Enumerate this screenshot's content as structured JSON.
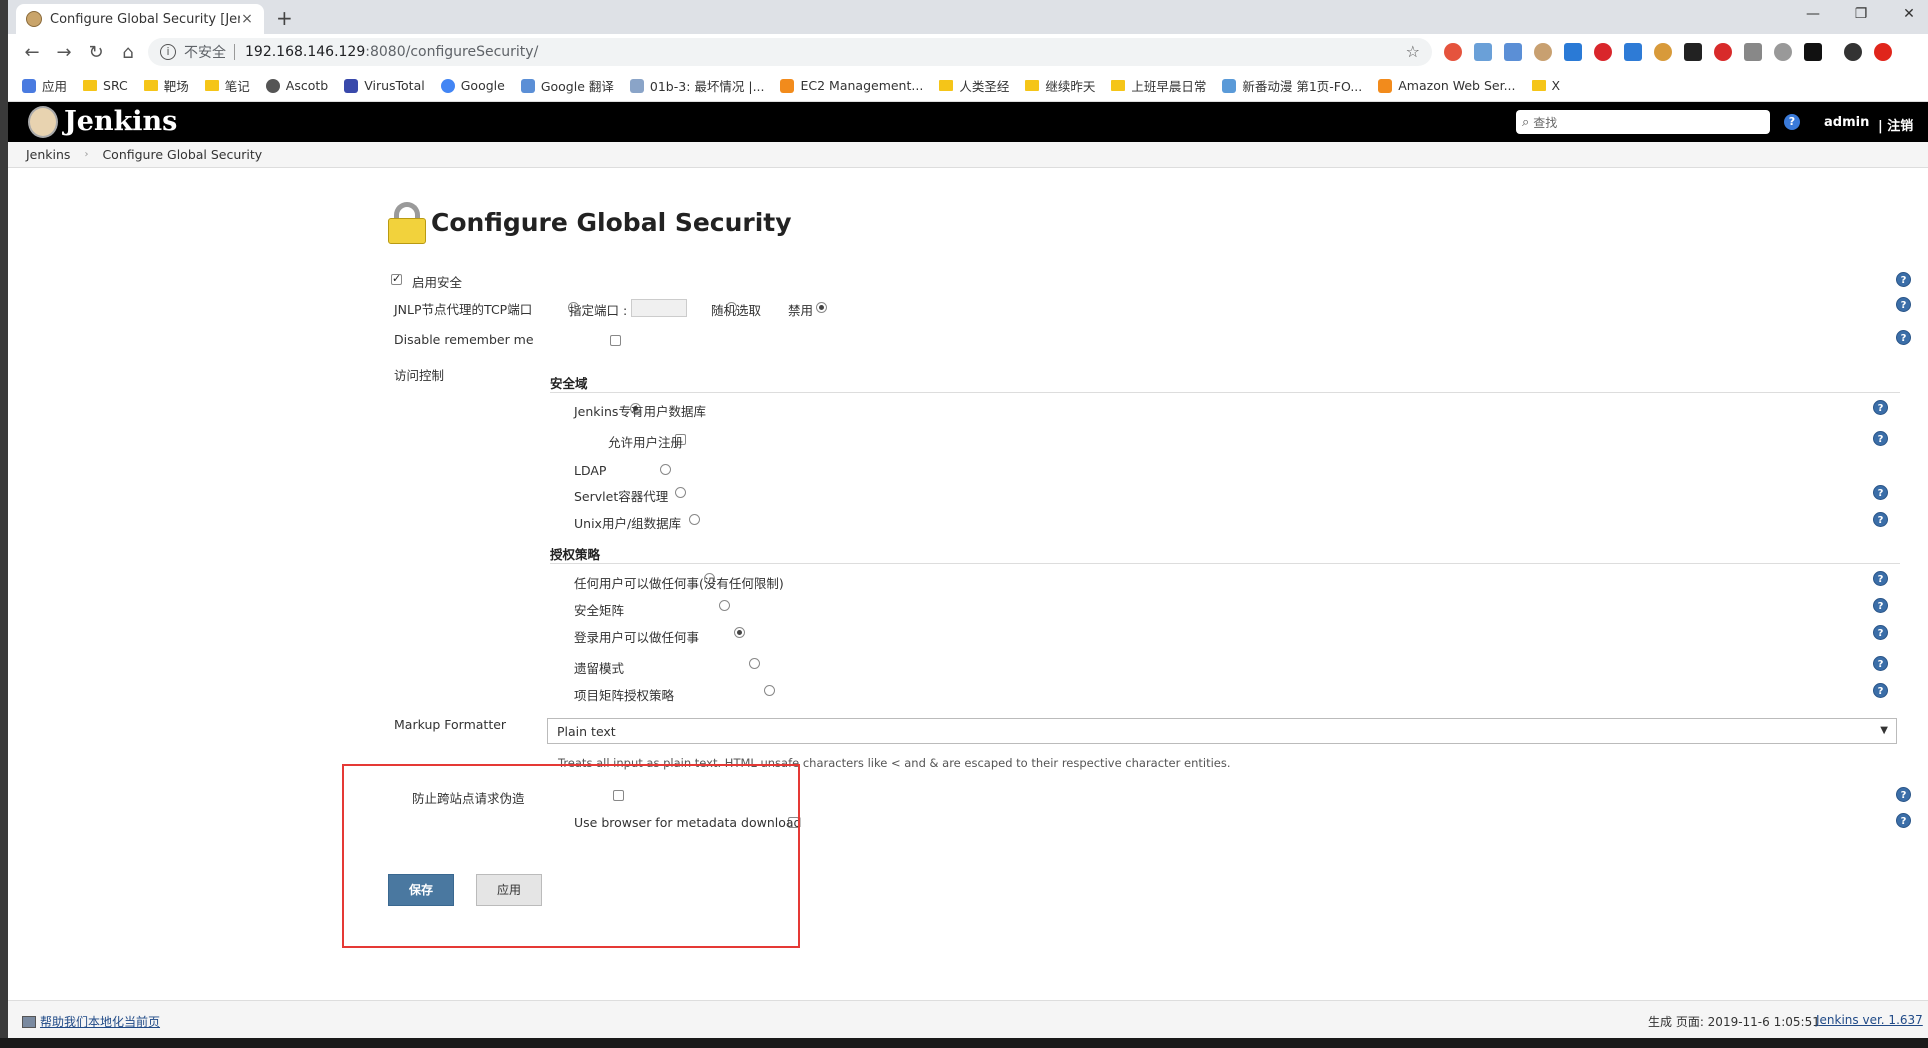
{
  "browser": {
    "tab_title": "Configure Global Security [Jen",
    "new_tab": "+",
    "close_tab": "×",
    "not_secure": "不安全",
    "url_host": "192.168.146.129",
    "url_path": ":8080/configureSecurity/",
    "window_min": "—",
    "window_restore": "❐",
    "window_close": "✕"
  },
  "bookmarks": [
    {
      "label": "应用",
      "icon": "apps-grid-icon"
    },
    {
      "label": "SRC",
      "icon": "folder-icon"
    },
    {
      "label": "靶场",
      "icon": "folder-icon"
    },
    {
      "label": "笔记",
      "icon": "folder-icon"
    },
    {
      "label": "Ascotb",
      "icon": "person-icon"
    },
    {
      "label": "VirusTotal",
      "icon": "virustotal-icon"
    },
    {
      "label": "Google",
      "icon": "google-icon"
    },
    {
      "label": "Google 翻译",
      "icon": "translate-icon"
    },
    {
      "label": "01b-3: 最坏情况 |...",
      "icon": "page-icon"
    },
    {
      "label": "EC2 Management...",
      "icon": "aws-icon"
    },
    {
      "label": "人类圣经",
      "icon": "folder-icon"
    },
    {
      "label": "继续昨天",
      "icon": "folder-icon"
    },
    {
      "label": "上班早晨日常",
      "icon": "folder-icon"
    },
    {
      "label": "新番动漫 第1页-FO...",
      "icon": "image-icon"
    },
    {
      "label": "Amazon Web Ser...",
      "icon": "aws-icon"
    },
    {
      "label": "X",
      "icon": "folder-icon"
    }
  ],
  "header": {
    "title": "Jenkins",
    "search_placeholder": "查找",
    "help": "?",
    "user": "admin",
    "logout": "| 注销"
  },
  "breadcrumb": {
    "root": "Jenkins",
    "sep": "›",
    "current": "Configure Global Security"
  },
  "page": {
    "title": "Configure Global Security",
    "enable_security": "启用安全",
    "jnlp_label": "JNLP节点代理的TCP端口",
    "jnlp_fixed": "指定端口 :",
    "jnlp_random": "随机选取",
    "jnlp_disable": "禁用",
    "disable_remember_me": "Disable remember me",
    "access_control": "访问控制",
    "security_realm": "安全域",
    "realm_jenkins_db": "Jenkins专有用户数据库",
    "allow_signup": "允许用户注册",
    "realm_ldap": "LDAP",
    "realm_servlet": "Servlet容器代理",
    "realm_unix": "Unix用户/组数据库",
    "authorization": "授权策略",
    "auth_anyone": "任何用户可以做任何事(没有任何限制)",
    "auth_matrix": "安全矩阵",
    "auth_logged_in": "登录用户可以做任何事",
    "auth_legacy": "遗留模式",
    "auth_project_matrix": "项目矩阵授权策略",
    "markup_formatter": "Markup Formatter",
    "markup_value": "Plain text",
    "markup_desc": "Treats all input as plain text. HTML unsafe characters like < and & are escaped to their respective character entities.",
    "csrf": "防止跨站点请求伪造",
    "browser_metadata": "Use browser for metadata download",
    "save": "保存",
    "apply": "应用",
    "help": "?"
  },
  "footer": {
    "localize": "帮助我们本地化当前页",
    "generated": "生成 页面: 2019-11-6 1:05:51",
    "version": "Jenkins ver. 1.637"
  },
  "colors": {
    "header_bg": "#000000",
    "save_btn": "#4a78a0",
    "highlight_box": "#e53935"
  }
}
